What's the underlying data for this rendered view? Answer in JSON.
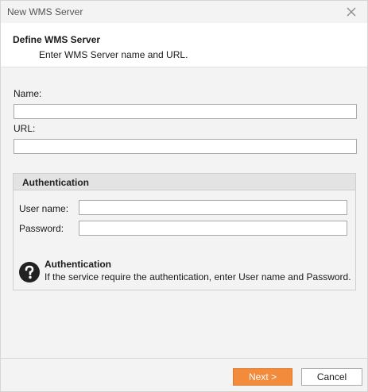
{
  "window": {
    "title": "New WMS Server"
  },
  "header": {
    "title": "Define WMS Server",
    "subtitle": "Enter WMS Server name and URL."
  },
  "form": {
    "name_label": "Name:",
    "name_value": "",
    "url_label": "URL:",
    "url_value": ""
  },
  "authentication": {
    "group_title": "Authentication",
    "username_label": "User name:",
    "username_value": "",
    "password_label": "Password:",
    "password_value": "",
    "help_title": "Authentication",
    "help_text": "If the service require the authentication, enter User name and Password."
  },
  "footer": {
    "next_label": "Next >",
    "cancel_label": "Cancel"
  },
  "colors": {
    "accent": "#f28b3c",
    "help_icon": "#222222"
  },
  "icons": {
    "close": "close-icon",
    "help": "question-circle-icon"
  }
}
